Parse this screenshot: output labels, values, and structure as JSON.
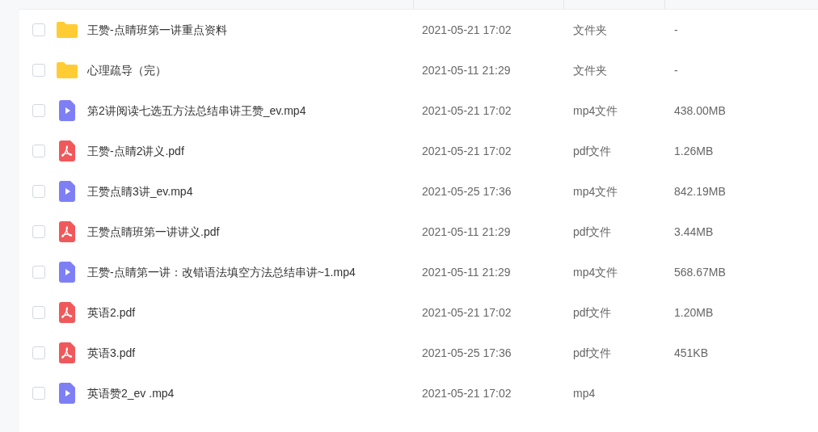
{
  "files": [
    {
      "kind": "folder",
      "name": "王赞-点睛班第一讲重点资料",
      "date": "2021-05-21 17:02",
      "type": "文件夹",
      "size": "-",
      "checked": false
    },
    {
      "kind": "folder",
      "name": "心理疏导（完）",
      "date": "2021-05-11 21:29",
      "type": "文件夹",
      "size": "-",
      "checked": false
    },
    {
      "kind": "video",
      "name": "第2讲阅读七选五方法总结串讲王赞_ev.mp4",
      "date": "2021-05-21 17:02",
      "type": "mp4文件",
      "size": "438.00MB",
      "checked": false
    },
    {
      "kind": "pdf",
      "name": "王赞-点睛2讲义.pdf",
      "date": "2021-05-21 17:02",
      "type": "pdf文件",
      "size": "1.26MB",
      "checked": false
    },
    {
      "kind": "video",
      "name": "王赞点睛3讲_ev.mp4",
      "date": "2021-05-25 17:36",
      "type": "mp4文件",
      "size": "842.19MB",
      "checked": false
    },
    {
      "kind": "pdf",
      "name": "王赞点睛班第一讲讲义.pdf",
      "date": "2021-05-11 21:29",
      "type": "pdf文件",
      "size": "3.44MB",
      "checked": false
    },
    {
      "kind": "video",
      "name": "王赞-点睛第一讲：改错语法填空方法总结串讲~1.mp4",
      "date": "2021-05-11 21:29",
      "type": "mp4文件",
      "size": "568.67MB",
      "checked": false
    },
    {
      "kind": "pdf",
      "name": "英语2.pdf",
      "date": "2021-05-21 17:02",
      "type": "pdf文件",
      "size": "1.20MB",
      "checked": false
    },
    {
      "kind": "pdf",
      "name": "英语3.pdf",
      "date": "2021-05-25 17:36",
      "type": "pdf文件",
      "size": "451KB",
      "checked": false
    },
    {
      "kind": "video",
      "name": "英语赞2_ev .mp4",
      "date": "2021-05-21 17:02",
      "type": "mp4",
      "checked": false
    }
  ]
}
